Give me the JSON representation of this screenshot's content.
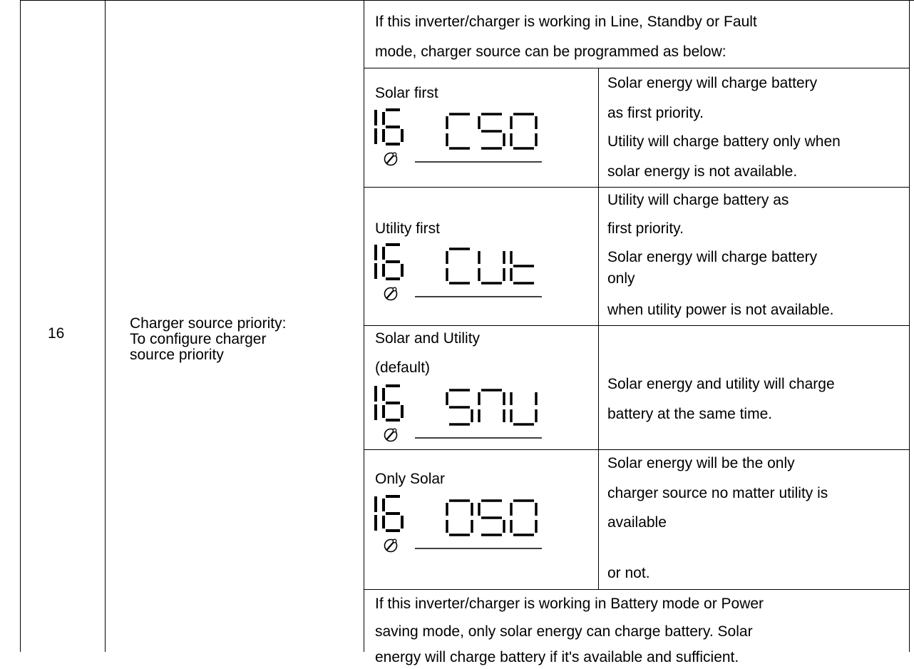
{
  "setting": {
    "number": "16",
    "description_lines": [
      "Charger source priority:",
      "To configure charger",
      "source priority"
    ]
  },
  "intro_lines": [
    "If this inverter/charger is working in Line, Standby or Fault",
    "mode, charger source can be programmed as below:"
  ],
  "options": [
    {
      "label_lines": [
        "Solar first"
      ],
      "lcd": {
        "number": "16",
        "code": "CSO"
      },
      "description_lines": [
        "Solar energy will charge battery",
        "as first priority.",
        "Utility will charge battery only when",
        "solar energy is not available."
      ]
    },
    {
      "label_lines": [
        "Utility first"
      ],
      "lcd": {
        "number": "16",
        "code": "CUt"
      },
      "description_lines": [
        "Utility will charge battery as",
        "first priority.",
        "Solar energy will charge battery",
        "only",
        "when utility power is not available."
      ]
    },
    {
      "label_lines": [
        "Solar and Utility",
        "(default)"
      ],
      "lcd": {
        "number": "16",
        "code": "SNU"
      },
      "description_lines": [
        "Solar energy and utility will charge",
        "battery at the same time."
      ]
    },
    {
      "label_lines": [
        "Only Solar"
      ],
      "lcd": {
        "number": "16",
        "code": "OSO"
      },
      "description_lines": [
        "Solar energy will be the only",
        "charger source no matter utility is",
        "available",
        "or not."
      ]
    }
  ],
  "outro_lines": [
    "If this inverter/charger is working in Battery mode or Power",
    "saving mode, only solar energy can charge battery. Solar",
    "energy will charge battery if it's available and sufficient."
  ],
  "icons": {
    "setting_icon": "wrench-icon"
  }
}
